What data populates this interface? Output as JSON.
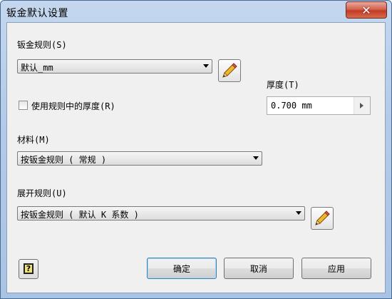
{
  "window": {
    "title": "钣金默认设置",
    "close_icon": "close-icon"
  },
  "sheet_metal_rule": {
    "label": "钣金规则(S)",
    "value": "默认_mm",
    "edit_icon": "pencil-icon"
  },
  "thickness": {
    "label": "厚度(T)",
    "value": "0.700 mm"
  },
  "use_rule_thickness": {
    "label": "使用规则中的厚度(R)",
    "checked": false
  },
  "material": {
    "label": "材料(M)",
    "value": "按钣金规则 ( 常规 )"
  },
  "unfold_rule": {
    "label": "展开规则(U)",
    "value": "按钣金规则 ( 默认 K 系数 )",
    "edit_icon": "pencil-icon"
  },
  "buttons": {
    "ok": "确定",
    "cancel": "取消",
    "apply": "应用",
    "help_icon": "help-icon",
    "help_glyph": "?"
  },
  "colors": {
    "close_button": "#c23b24",
    "frame": "#b3cbe8",
    "client_bg": "#f0f0f0",
    "default_button_border": "#3c7fb1"
  }
}
